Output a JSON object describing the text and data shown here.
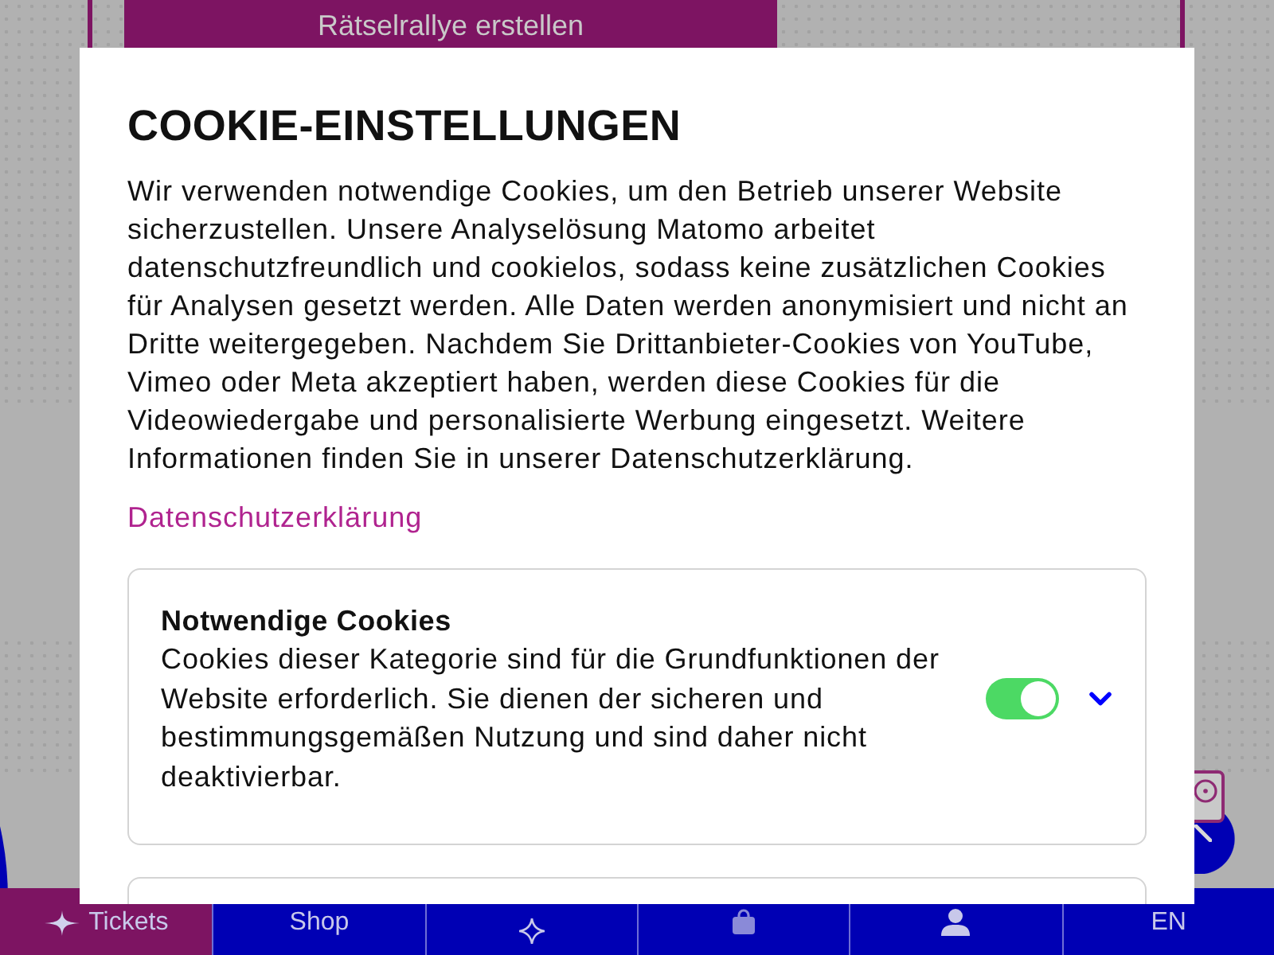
{
  "background": {
    "banner": "Rätselrallye erstellen"
  },
  "dialog": {
    "title": "COOKIE-EINSTELLUNGEN",
    "text": "Wir verwenden notwendige Cookies, um den Betrieb unserer Website sicherzustellen. Unsere Analyselösung Matomo arbeitet datenschutzfreundlich und cookielos, sodass keine zusätzlichen Cookies für Analysen gesetzt werden. Alle Daten werden anonymisiert und nicht an Dritte weitergegeben. Nachdem Sie Drittanbieter-Cookies von YouTube, Vimeo oder Meta akzeptiert haben, werden diese Cookies für die Videowiedergabe und personalisierte Werbung eingesetzt. Weitere Informationen finden Sie in unserer Datenschutzerklärung.",
    "link": "Datenschutzerklärung",
    "categories": [
      {
        "title": "Notwendige Cookies",
        "description": "Cookies dieser Kategorie sind für die Grundfunktionen der Website erforderlich. Sie dienen der sicheren und bestimmungsgemäßen Nutzung und sind daher nicht deaktivierbar.",
        "on": true,
        "expanded": false
      }
    ]
  },
  "nav": [
    {
      "label": "Tickets",
      "selected": true
    },
    {
      "label": "Shop",
      "selected": false
    },
    {
      "selected": false
    },
    {
      "selected": false
    },
    {
      "selected": false
    },
    {
      "label": "EN",
      "selected": false
    }
  ]
}
